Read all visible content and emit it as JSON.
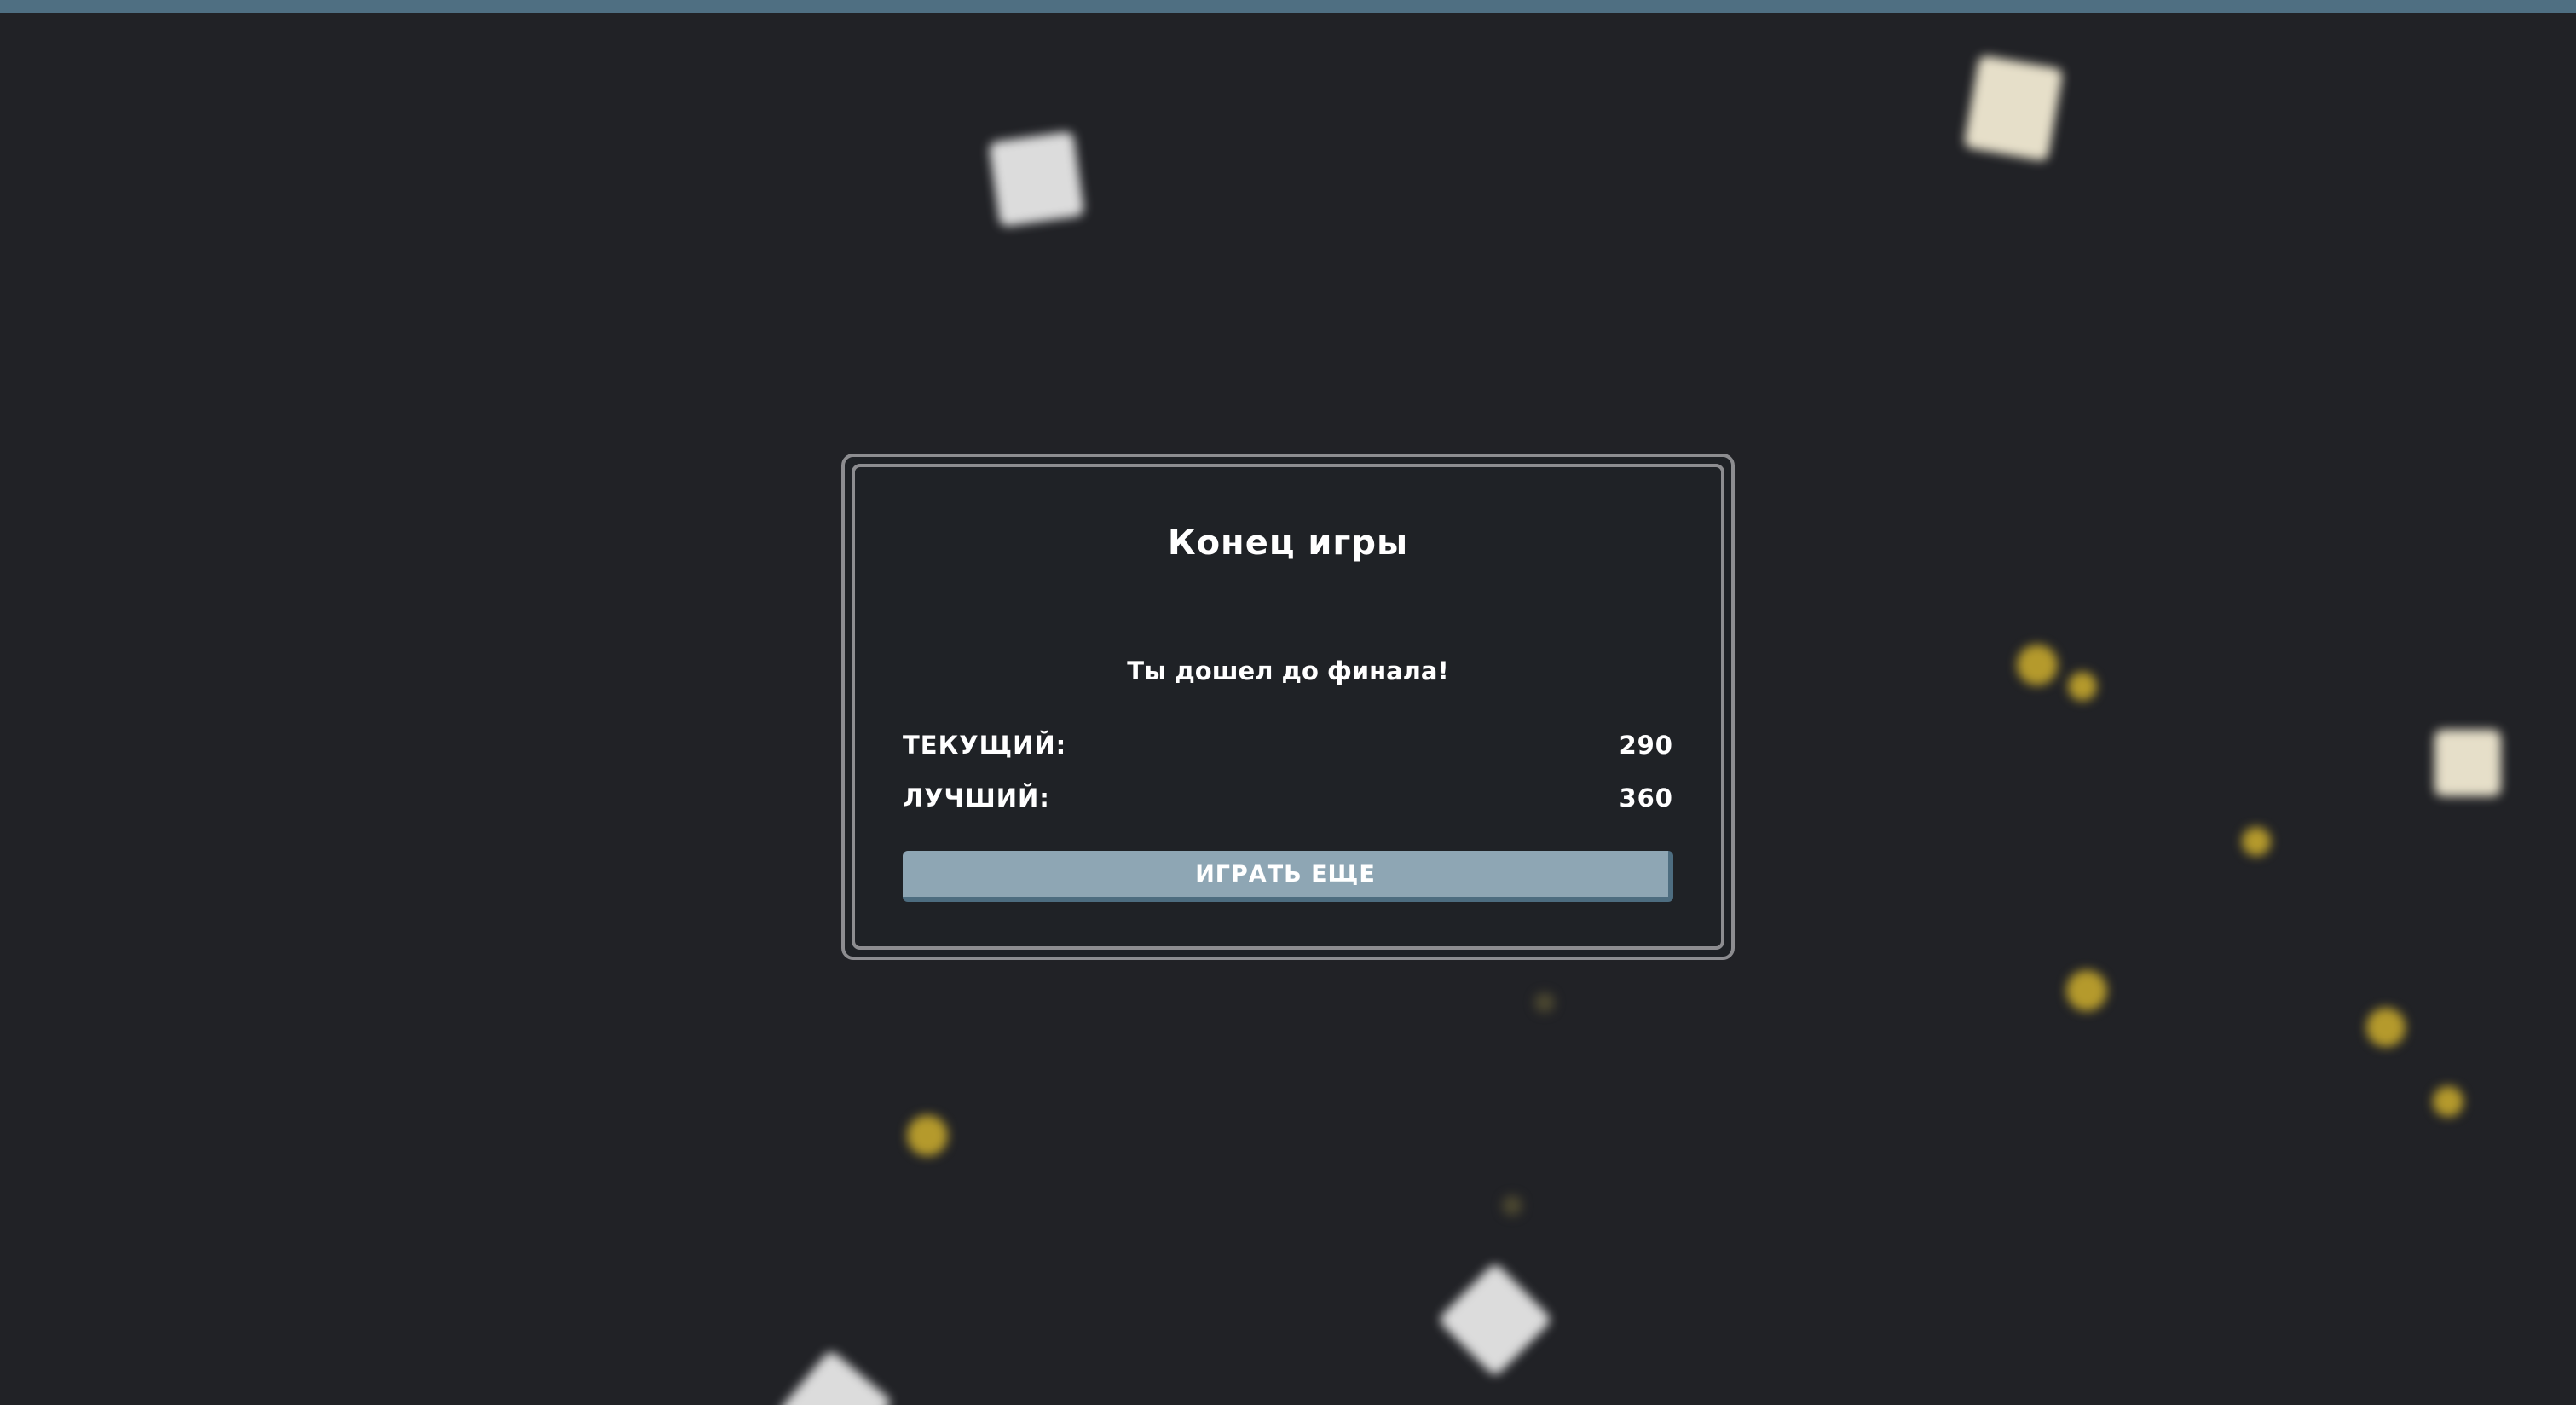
{
  "colors": {
    "background": "#212226",
    "top_bar": "#4f6f82",
    "modal_background": "#1f2226",
    "modal_border": "#8d8d90",
    "button_background": "#8ea6b4",
    "button_shadow": "#4d6d80",
    "text": "#ffffff",
    "coin": "#b59a2c",
    "cube": "#dcdcdc"
  },
  "game_over": {
    "title": "Конец игры",
    "message": "Ты дошел до финала!",
    "current_label": "ТЕКУЩИЙ:",
    "current_value": "290",
    "best_label": "ЛУЧШИЙ:",
    "best_value": "360",
    "play_again_label": "ИГРАТЬ ЕЩЕ"
  }
}
